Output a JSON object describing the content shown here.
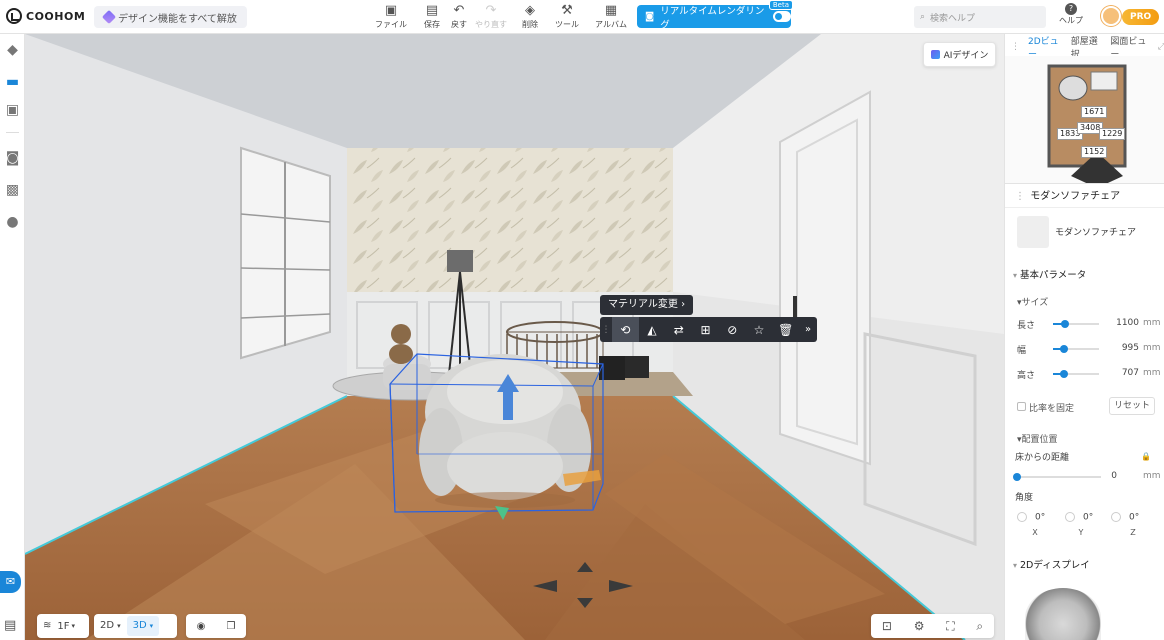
{
  "app": {
    "logo_text": "COOHOM",
    "unlock_label": "デザイン機能をすべて解放"
  },
  "toolbar": [
    {
      "label": "ファイル",
      "icon": "file-icon",
      "glyph": "▣"
    },
    {
      "label": "保存",
      "icon": "save-icon",
      "glyph": "▤"
    },
    {
      "label": "戻す",
      "icon": "undo-icon",
      "glyph": "↶"
    },
    {
      "label": "やり直す",
      "icon": "redo-icon",
      "glyph": "↷"
    },
    {
      "label": "削除",
      "icon": "eraser-icon",
      "glyph": "◈"
    },
    {
      "label": "ツール",
      "icon": "wrench-icon",
      "glyph": "⚒"
    },
    {
      "label": "アルバム",
      "icon": "album-icon",
      "glyph": "▦"
    }
  ],
  "render": {
    "label": "リアルタイムレンダリング",
    "badge": "Beta"
  },
  "search": {
    "placeholder": "検索ヘルプ"
  },
  "help_label": "ヘルプ",
  "pro_label": "PRO",
  "ai_design_label": "AIデザイン",
  "selection": {
    "tooltip": "マテリアル変更 ›",
    "actions": [
      "rotate-icon",
      "mirror-icon",
      "swap-icon",
      "copy-icon",
      "hide-icon",
      "star-icon",
      "trash-icon",
      "more-icon"
    ]
  },
  "bottom_bar": {
    "floor": "1F",
    "view_2d": "2D",
    "view_3d": "3D"
  },
  "minimap": {
    "tabs": [
      "2Dビュー",
      "部屋選択",
      "図面ビュー"
    ],
    "labels": [
      "1671",
      "1833",
      "3408",
      "1229",
      "1152"
    ]
  },
  "properties": {
    "title": "モダンソファチェア",
    "item_name": "モダンソファチェア",
    "section_basic": "基本パラメータ",
    "section_size": "サイズ",
    "size_rows": [
      {
        "label": "長さ",
        "value": "1100",
        "unit": "mm",
        "level": 0.26
      },
      {
        "label": "幅",
        "value": "995",
        "unit": "mm",
        "level": 0.23
      },
      {
        "label": "高さ",
        "value": "707",
        "unit": "mm",
        "level": 0.23
      }
    ],
    "keep_ratio_label": "比率を固定",
    "reset_label": "リセット",
    "section_position": "配置位置",
    "floor_distance_label": "床からの距離",
    "floor_distance_value": "0",
    "floor_distance_unit": "mm",
    "angle_label": "角度",
    "angles": [
      {
        "axis": "X",
        "value": "0°"
      },
      {
        "axis": "Y",
        "value": "0°"
      },
      {
        "axis": "Z",
        "value": "0°"
      }
    ],
    "section_2d": "2Dディスプレイ"
  },
  "colors": {
    "accent": "#1a86d8",
    "render_button": "#1a9be8",
    "floor_wood": "#a96f45"
  }
}
